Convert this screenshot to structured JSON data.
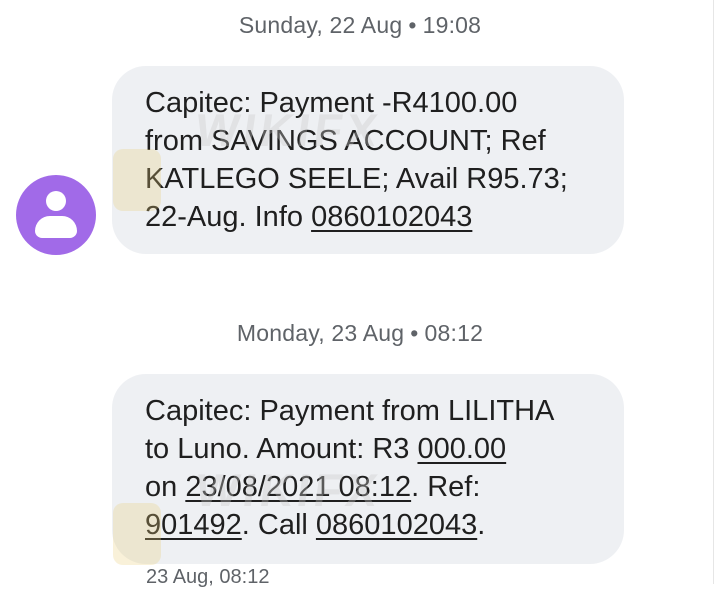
{
  "conversation": {
    "groups": [
      {
        "date_header": {
          "day": "Sunday, 22 Aug",
          "separator": "•",
          "time": "19:08"
        },
        "message": {
          "lines": [
            [
              "Capitec: Payment -R4100.00"
            ],
            [
              "from SAVINGS ACCOUNT; Ref"
            ],
            [
              "KATLEGO SEELE; Avail R95.73;"
            ],
            [
              "22-Aug. Info ",
              "0860102043"
            ]
          ]
        }
      },
      {
        "date_header": {
          "day": "Monday, 23 Aug",
          "separator": "•",
          "time": "08:12"
        },
        "message": {
          "lines": [
            [
              "Capitec: Payment from LILITHA"
            ],
            [
              "to Luno. Amount: R3 ",
              "000.00"
            ],
            [
              "on ",
              "23/08/2021 08:12",
              ". Ref:"
            ],
            [
              "901492",
              ". Call ",
              "0860102043",
              "."
            ]
          ]
        },
        "timestamp": "23 Aug, 08:12"
      }
    ]
  },
  "sender_avatar": {
    "icon": "person-icon",
    "color": "#a16ae8"
  },
  "watermark": {
    "text": "WIKIFX"
  },
  "colors": {
    "bubble_bg": "#eef0f3",
    "header_text": "#5f6368",
    "message_text": "#1f1f1f"
  }
}
